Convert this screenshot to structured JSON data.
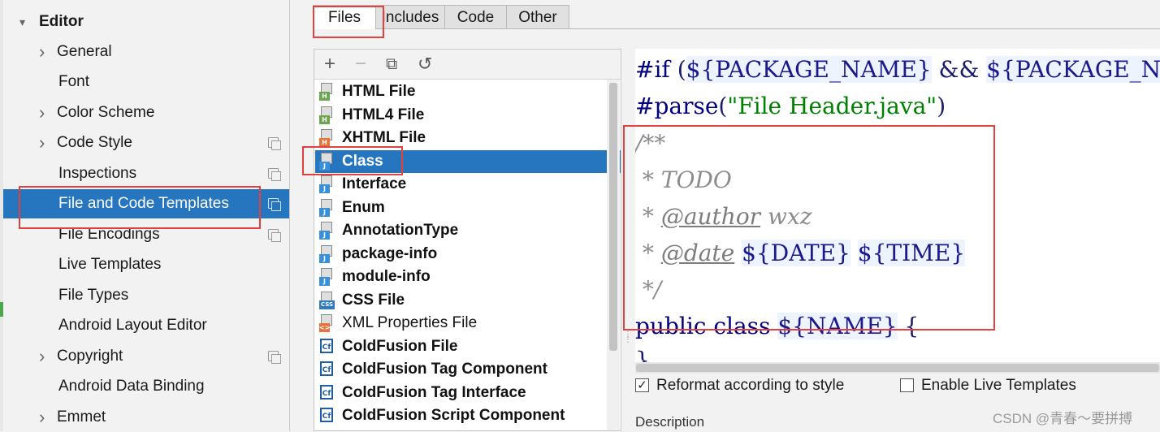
{
  "settings_tree": {
    "items": [
      {
        "label": "Editor",
        "expander": "expanded",
        "bold": true,
        "copy_icon": false,
        "selected": false
      },
      {
        "label": "General",
        "expander": "collapsed",
        "copy_icon": false,
        "selected": false
      },
      {
        "label": "Font",
        "expander": "none",
        "copy_icon": false,
        "selected": false
      },
      {
        "label": "Color Scheme",
        "expander": "collapsed",
        "copy_icon": false,
        "selected": false
      },
      {
        "label": "Code Style",
        "expander": "collapsed",
        "copy_icon": true,
        "selected": false
      },
      {
        "label": "Inspections",
        "expander": "none",
        "copy_icon": true,
        "selected": false
      },
      {
        "label": "File and Code Templates",
        "expander": "none",
        "copy_icon": true,
        "selected": true
      },
      {
        "label": "File Encodings",
        "expander": "none",
        "copy_icon": true,
        "selected": false
      },
      {
        "label": "Live Templates",
        "expander": "none",
        "copy_icon": false,
        "selected": false
      },
      {
        "label": "File Types",
        "expander": "none",
        "copy_icon": false,
        "selected": false
      },
      {
        "label": "Android Layout Editor",
        "expander": "none",
        "copy_icon": false,
        "selected": false
      },
      {
        "label": "Copyright",
        "expander": "collapsed",
        "copy_icon": true,
        "selected": false
      },
      {
        "label": "Android Data Binding",
        "expander": "none",
        "copy_icon": false,
        "selected": false
      },
      {
        "label": "Emmet",
        "expander": "collapsed",
        "copy_icon": false,
        "selected": false
      }
    ]
  },
  "tabs": [
    {
      "label": "Files",
      "active": true
    },
    {
      "label": "Includes",
      "active": false
    },
    {
      "label": "Code",
      "active": false
    },
    {
      "label": "Other",
      "active": false
    }
  ],
  "toolbar": {
    "add_icon": "plus-icon",
    "remove_icon": "minus-icon",
    "copy_icon": "copy-icon",
    "reset_icon": "undo-icon"
  },
  "templates": [
    {
      "label": "HTML File",
      "icon": "H",
      "badge_color": "#6aa84f",
      "bold": true,
      "selected": false
    },
    {
      "label": "HTML4 File",
      "icon": "H",
      "badge_color": "#6aa84f",
      "bold": true,
      "selected": false
    },
    {
      "label": "XHTML File",
      "icon": "H",
      "badge_color": "#e8743b",
      "bold": true,
      "selected": false
    },
    {
      "label": "Class",
      "icon": "J",
      "badge_color": "#3a8fd9",
      "bold": true,
      "selected": true
    },
    {
      "label": "Interface",
      "icon": "J",
      "badge_color": "#3a8fd9",
      "bold": true,
      "selected": false
    },
    {
      "label": "Enum",
      "icon": "J",
      "badge_color": "#3a8fd9",
      "bold": true,
      "selected": false
    },
    {
      "label": "AnnotationType",
      "icon": "J",
      "badge_color": "#3a8fd9",
      "bold": true,
      "selected": false
    },
    {
      "label": "package-info",
      "icon": "J",
      "badge_color": "#3a8fd9",
      "bold": true,
      "selected": false
    },
    {
      "label": "module-info",
      "icon": "J",
      "badge_color": "#3a8fd9",
      "bold": true,
      "selected": false
    },
    {
      "label": "CSS File",
      "icon": "CSS",
      "badge_color": "#2f7bbf",
      "bold": true,
      "selected": false
    },
    {
      "label": "XML Properties File",
      "icon": "<>",
      "badge_color": "#e8743b",
      "bold": false,
      "selected": false
    },
    {
      "label": "ColdFusion File",
      "icon": "Cf",
      "badge_color": "#1f5fa6",
      "bold": true,
      "selected": false
    },
    {
      "label": "ColdFusion Tag Component",
      "icon": "Cf",
      "badge_color": "#1f5fa6",
      "bold": true,
      "selected": false
    },
    {
      "label": "ColdFusion Tag Interface",
      "icon": "Cf",
      "badge_color": "#1f5fa6",
      "bold": true,
      "selected": false
    },
    {
      "label": "ColdFusion Script Component",
      "icon": "Cf",
      "badge_color": "#1f5fa6",
      "bold": true,
      "selected": false
    }
  ],
  "editor": {
    "lines": [
      [
        {
          "t": "#if ",
          "c": "kw"
        },
        {
          "t": "(",
          "c": "plain"
        },
        {
          "t": "${PACKAGE_NAME}",
          "c": "var"
        },
        {
          "t": " && ",
          "c": "plain"
        },
        {
          "t": "${PACKAGE_NAME}",
          "c": "var"
        },
        {
          "t": " !",
          "c": "plain"
        }
      ],
      [
        {
          "t": "#parse",
          "c": "kw"
        },
        {
          "t": "(",
          "c": "plain"
        },
        {
          "t": "\"File Header.java\"",
          "c": "str"
        },
        {
          "t": ")",
          "c": "plain"
        }
      ],
      [
        {
          "t": "/**",
          "c": "cmt"
        }
      ],
      [
        {
          "t": " * TODO",
          "c": "cmt"
        }
      ],
      [
        {
          "t": " * ",
          "c": "cmt"
        },
        {
          "t": "@author",
          "c": "tag"
        },
        {
          "t": " wxz",
          "c": "cmt"
        }
      ],
      [
        {
          "t": " * ",
          "c": "cmt"
        },
        {
          "t": "@date",
          "c": "tag"
        },
        {
          "t": " ",
          "c": "plain"
        },
        {
          "t": "${DATE}",
          "c": "var"
        },
        {
          "t": " ",
          "c": "plain"
        },
        {
          "t": "${TIME}",
          "c": "var"
        }
      ],
      [
        {
          "t": " */",
          "c": "cmt"
        }
      ],
      [
        {
          "t": "public class ",
          "c": "kw"
        },
        {
          "t": "${NAME}",
          "c": "var"
        },
        {
          "t": " {",
          "c": "plain"
        }
      ],
      [
        {
          "t": "}",
          "c": "plain"
        }
      ]
    ]
  },
  "options": {
    "reformat": {
      "label": "Reformat according to style",
      "checked": true
    },
    "live_templates": {
      "label": "Enable Live Templates",
      "checked": false
    }
  },
  "description_label": "Description",
  "watermark": "CSDN @青春～要拼搏",
  "annotation_color": "#e34040"
}
